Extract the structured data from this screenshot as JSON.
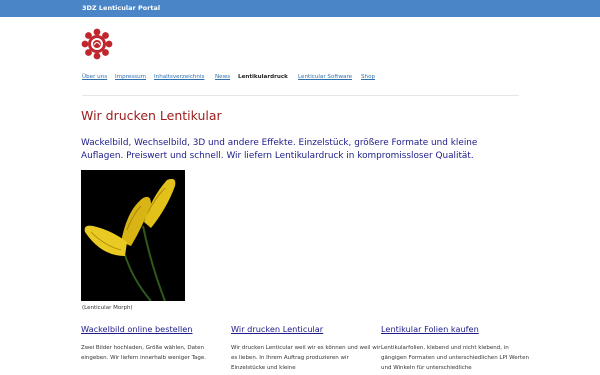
{
  "header": {
    "brand": "3DZ Lenticular Portal"
  },
  "nav": {
    "items": [
      {
        "label": "Über uns"
      },
      {
        "label": "Impressum"
      },
      {
        "label": "Inhaltsverzeichnis"
      },
      {
        "label": "News"
      },
      {
        "label": "Lentikulardruck",
        "active": true
      },
      {
        "label": "Lenticular Software"
      },
      {
        "label": "Shop"
      }
    ]
  },
  "main": {
    "title": "Wir drucken Lentikular",
    "lead": "Wackelbild, Wechselbild, 3D und andere Effekte. Einzelstück, größere Formate und kleine Auflagen. Preiswert und schnell. Wir liefern Lentikulardruck in kompromissloser Qualität.",
    "image_caption": "(Lenticular Morph)"
  },
  "columns": [
    {
      "heading": "Wackelbild online bestellen",
      "text": "Zwei Bilder hochladen, Größe wählen, Daten eingeben. Wir liefern innerhalb weniger Tage."
    },
    {
      "heading": "Wir drucken Lenticular",
      "text": "Wir drucken Lenticular weil wir es können und weil wir es lieben. In Ihrem Auftrag produzieren wir Einzelstücke und kleine"
    },
    {
      "heading": "Lentikular Folien kaufen",
      "text": "Lentikularfolien, klebend und nicht klebend, in gängigen Formaten und unterschiedlichen LPI Werten und Winkeln für unterschiedliche"
    }
  ],
  "colors": {
    "topbar": "#4a86c7",
    "title": "#9b1b1b",
    "link": "#2e6fae",
    "lead": "#1c1c8a"
  }
}
